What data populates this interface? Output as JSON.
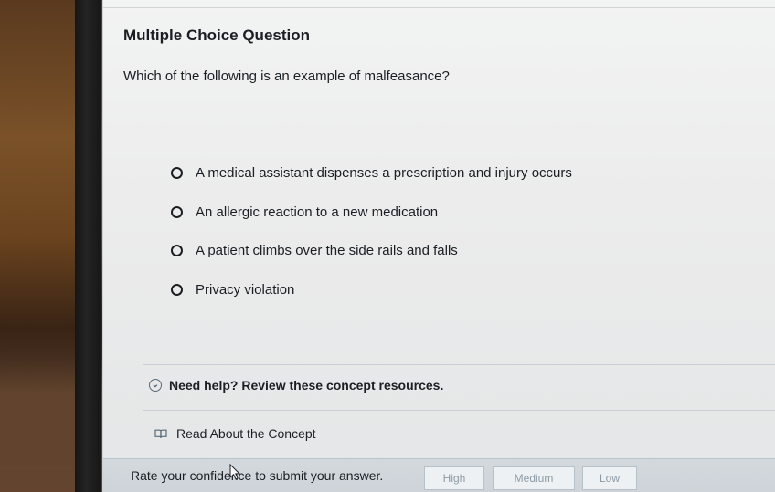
{
  "question_card": {
    "title": "Multiple Choice Question",
    "prompt": "Which of the following is an example of malfeasance?",
    "options": [
      {
        "label": "A medical assistant dispenses a prescription and injury occurs"
      },
      {
        "label": "An allergic reaction to a new medication"
      },
      {
        "label": "A patient climbs over the side rails and falls"
      },
      {
        "label": "Privacy violation"
      }
    ]
  },
  "help": {
    "label": "Need help? Review these concept resources."
  },
  "resource": {
    "label": "Read About the Concept"
  },
  "confidence": {
    "prompt": "Rate your confidence to submit your answer.",
    "buttons": [
      {
        "label": "High"
      },
      {
        "label": "Medium"
      },
      {
        "label": "Low"
      }
    ]
  },
  "icons": {
    "radio": "radio-button-icon",
    "help": "circle-chevron-down-icon",
    "resource": "book-icon",
    "cursor": "mouse-cursor-icon"
  }
}
